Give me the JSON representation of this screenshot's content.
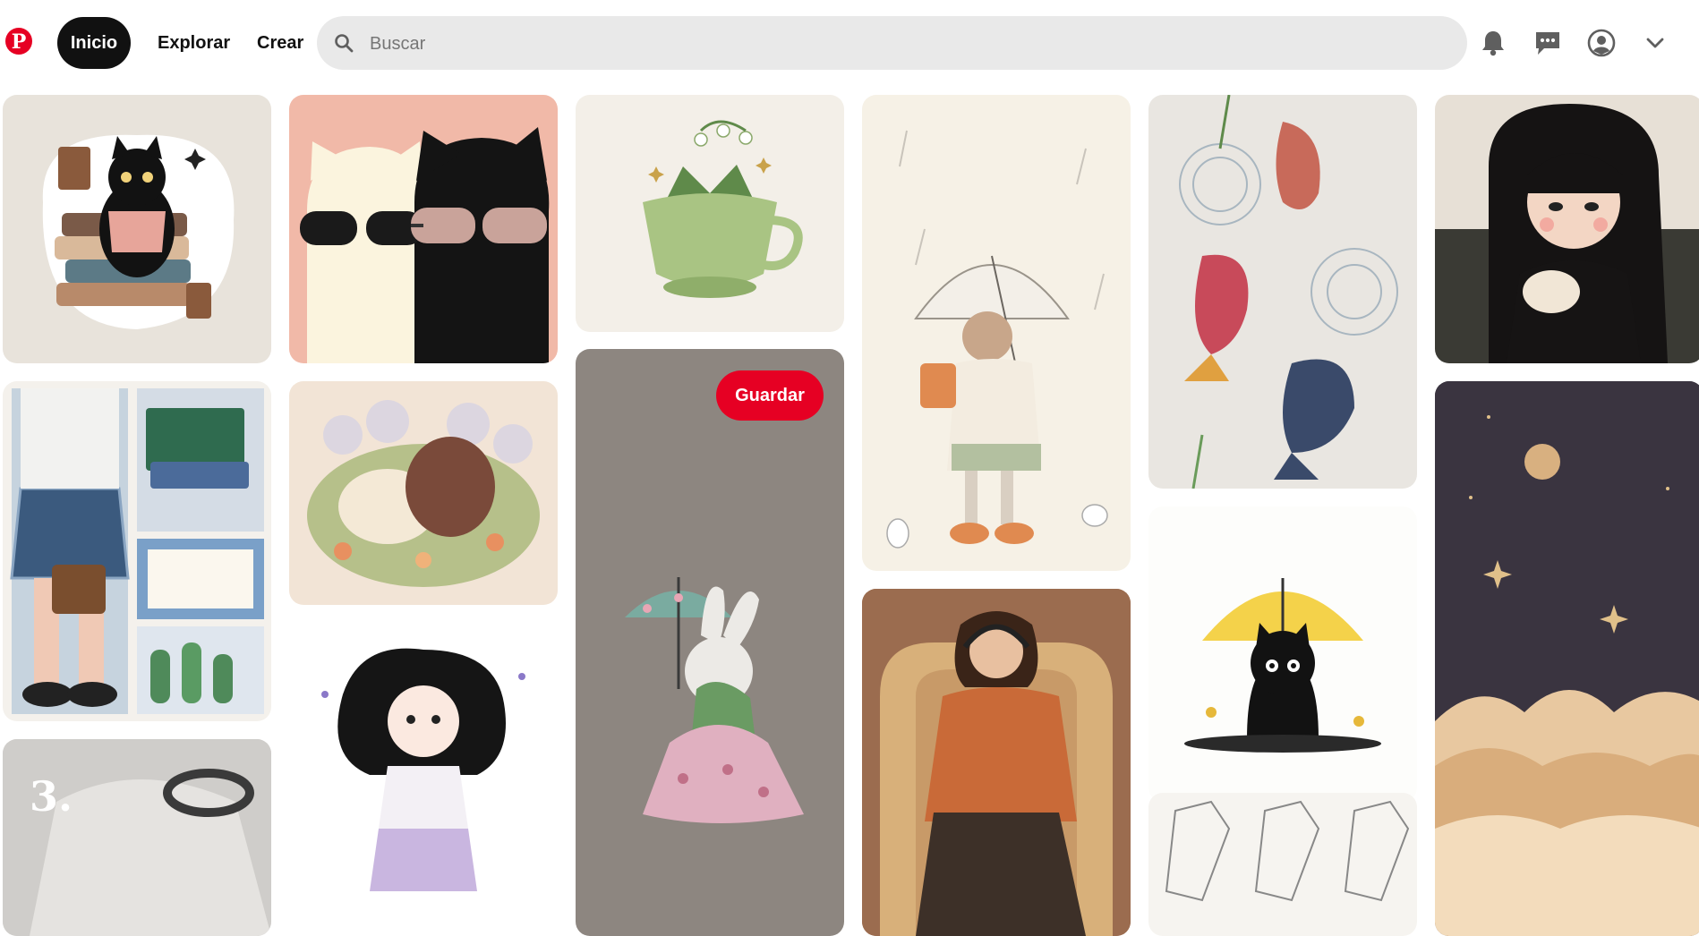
{
  "header": {
    "logo_letter": "P",
    "nav": {
      "home": "Inicio",
      "explore": "Explorar",
      "create": "Crear"
    },
    "search_placeholder": "Buscar"
  },
  "colors": {
    "brand": "#e60023",
    "dark": "#111111",
    "search_bg": "#e9e9e9"
  },
  "icons": [
    "search-icon",
    "bell-icon",
    "messages-icon",
    "profile-icon",
    "chevron-down-icon"
  ],
  "hovered_pin": {
    "save_label": "Guardar"
  },
  "pins": [
    {
      "id": "cat-reading-books"
    },
    {
      "id": "cats-sunglasses"
    },
    {
      "id": "teacup-flowers"
    },
    {
      "id": "girl-umbrella-rain"
    },
    {
      "id": "goldfish-koi"
    },
    {
      "id": "girl-holding-cat"
    },
    {
      "id": "school-collage"
    },
    {
      "id": "sleeping-cats-flowers"
    },
    {
      "id": "bunny-umbrella"
    },
    {
      "id": "girl-headphones-armchair"
    },
    {
      "id": "black-cat-yellow-umbrella"
    },
    {
      "id": "night-sky-clouds"
    },
    {
      "id": "fashion-flatlay"
    },
    {
      "id": "girl-curly-hair"
    },
    {
      "id": "clothing-sketch"
    }
  ]
}
